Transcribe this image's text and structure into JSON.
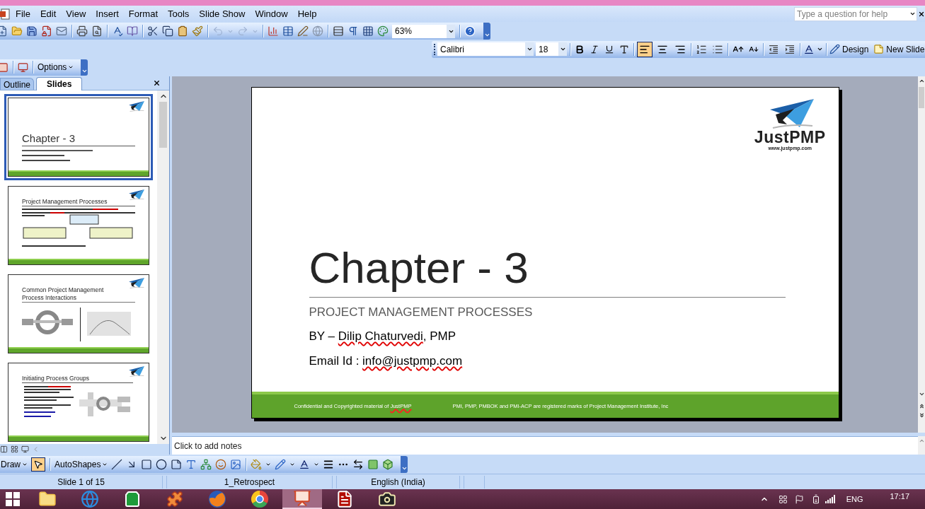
{
  "menu_bar": {
    "items": [
      "File",
      "Edit",
      "View",
      "Insert",
      "Format",
      "Tools",
      "Slide Show",
      "Window",
      "Help"
    ]
  },
  "help_box": {
    "placeholder": "Type a question for help"
  },
  "standard_toolbar": {
    "undo": {
      "disabled": true
    },
    "redo": {
      "disabled": true
    },
    "zoom": "63%"
  },
  "formatting_toolbar": {
    "font": "Calibri",
    "font_size": "18",
    "alignment": [
      {
        "kind": "left",
        "selected": true
      },
      {
        "kind": "center",
        "selected": false
      },
      {
        "kind": "right",
        "selected": false
      }
    ],
    "design": "Design",
    "new_slide": "New Slide"
  },
  "task_toolbar": {
    "options": "Options"
  },
  "slides_pane": {
    "tabs": [
      {
        "label": "Outline",
        "selected": false
      },
      {
        "label": "Slides",
        "selected": true
      }
    ],
    "thumbnails": [
      {
        "kind": "title",
        "title": "Chapter - 3",
        "selected": true
      },
      {
        "kind": "boxes",
        "title": "Project Management Processes",
        "selected": false
      },
      {
        "kind": "figures",
        "title": "Common Project Management Process Interactions",
        "selected": false
      },
      {
        "kind": "bullets",
        "title": "Initiating Process Groups",
        "selected": false
      }
    ]
  },
  "slide": {
    "logo": {
      "name": "JustPMP",
      "url": "www.justpmp.com"
    },
    "title": "Chapter - 3",
    "subtitle": "PROJECT MANAGEMENT PROCESSES",
    "lines": [
      {
        "segments": [
          {
            "text": "BY – ",
            "spell_error": false
          },
          {
            "text": "Dilip Chaturvedi",
            "spell_error": true
          },
          {
            "text": ", PMP",
            "spell_error": false
          }
        ]
      },
      {
        "segments": [
          {
            "text": "Email Id : ",
            "spell_error": false
          },
          {
            "text": "info@justpmp.com",
            "spell_error": true
          }
        ]
      }
    ],
    "footer": [
      {
        "segments": [
          {
            "text": "Confidential and Copyrighted material of ",
            "spell_error": false
          },
          {
            "text": "JustPMP",
            "spell_error": true
          }
        ]
      },
      {
        "segments": [
          {
            "text": "PMI, PMP, PMBOK and PMI-ACP are registered marks of Project Management Institute, Inc",
            "spell_error": false
          }
        ]
      }
    ]
  },
  "notes": {
    "placeholder": "Click to add notes"
  },
  "drawing_toolbar": {
    "draw": "Draw",
    "select_tool": {
      "selected": true
    },
    "autoshapes": "AutoShapes"
  },
  "status_bar": {
    "sections": [
      "Slide 1 of 15",
      "1_Retrospect",
      "English (India)"
    ]
  },
  "taskbar": {
    "apps": [
      {
        "kind": "folder",
        "selected": false
      },
      {
        "kind": "globe",
        "selected": false
      },
      {
        "kind": "bag",
        "selected": false
      },
      {
        "kind": "puzzle",
        "selected": false
      },
      {
        "kind": "fox",
        "selected": false
      },
      {
        "kind": "wheel",
        "selected": false
      },
      {
        "kind": "slides",
        "selected": true
      },
      {
        "kind": "pdf",
        "selected": false
      },
      {
        "kind": "camera",
        "selected": false
      }
    ],
    "language": "ENG",
    "time": "17:17"
  }
}
